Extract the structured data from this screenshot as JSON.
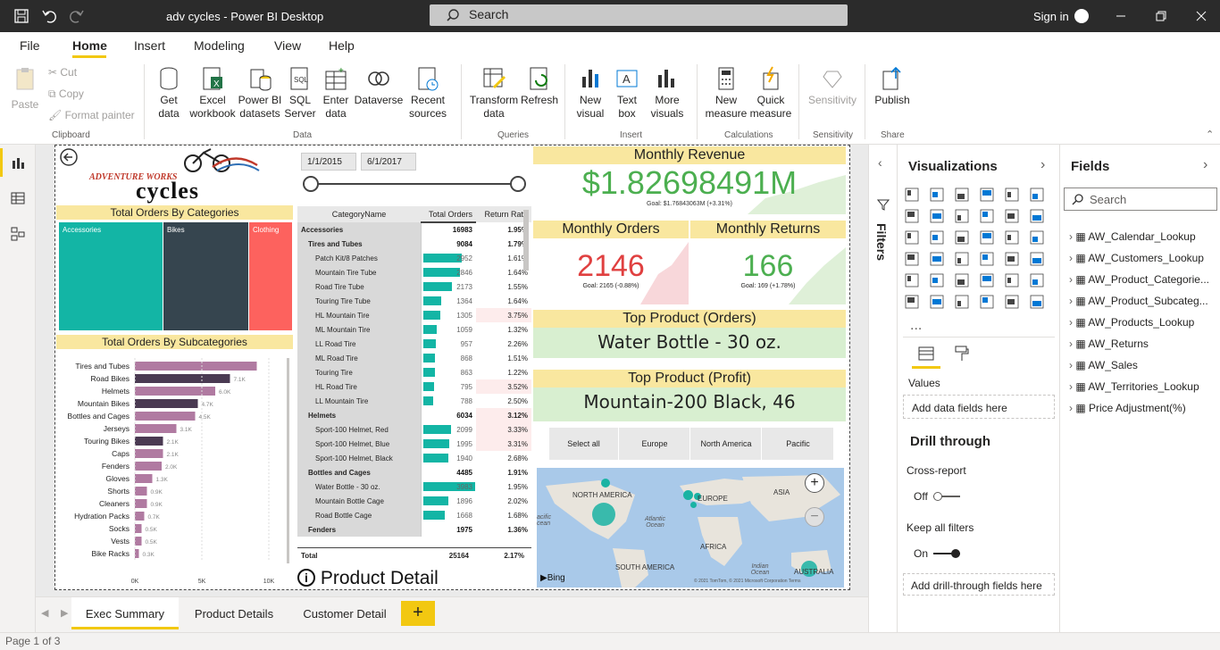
{
  "titlebar": {
    "title": "adv cycles - Power BI Desktop",
    "search": "Search",
    "sign_in": "Sign in"
  },
  "menu": [
    "File",
    "Home",
    "Insert",
    "Modeling",
    "View",
    "Help"
  ],
  "ribbon": {
    "paste": "Paste",
    "cut": "Cut",
    "copy": "Copy",
    "format_painter": "Format painter",
    "clipboard": "Clipboard",
    "get_data": "Get data",
    "excel": "Excel workbook",
    "pbi": "Power BI datasets",
    "sql": "SQL Server",
    "enter": "Enter data",
    "dataverse": "Dataverse",
    "recent": "Recent sources",
    "data": "Data",
    "transform": "Transform data",
    "refresh": "Refresh",
    "queries": "Queries",
    "new_visual": "New visual",
    "text_box": "Text box",
    "more_visuals": "More visuals",
    "insert": "Insert",
    "new_measure": "New measure",
    "quick_measure": "Quick measure",
    "calculations": "Calculations",
    "sensitivity": "Sensitivity",
    "sensitivity_group": "Sensitivity",
    "publish": "Publish",
    "share": "Share"
  },
  "report": {
    "logo_top": "ADVENTURE WORKS",
    "logo_bottom": "cycles",
    "date_from": "1/1/2015",
    "date_to": "6/1/2017",
    "orders_by_cat": "Total Orders By Categories",
    "treemap": [
      "Accessories",
      "Bikes",
      "Clothing"
    ],
    "orders_by_subcat": "Total Orders By Subcategories",
    "subcats": [
      {
        "name": "Tires and Tubes",
        "value": 9100,
        "label": ""
      },
      {
        "name": "Road Bikes",
        "value": 7100,
        "label": "7.1K"
      },
      {
        "name": "Helmets",
        "value": 6000,
        "label": "6.0K"
      },
      {
        "name": "Mountain Bikes",
        "value": 4700,
        "label": "4.7K"
      },
      {
        "name": "Bottles and Cages",
        "value": 4500,
        "label": "4.5K"
      },
      {
        "name": "Jerseys",
        "value": 3100,
        "label": "3.1K"
      },
      {
        "name": "Touring Bikes",
        "value": 2100,
        "label": "2.1K"
      },
      {
        "name": "Caps",
        "value": 2100,
        "label": "2.1K"
      },
      {
        "name": "Fenders",
        "value": 2000,
        "label": "2.0K"
      },
      {
        "name": "Gloves",
        "value": 1300,
        "label": "1.3K"
      },
      {
        "name": "Shorts",
        "value": 900,
        "label": "0.9K"
      },
      {
        "name": "Cleaners",
        "value": 900,
        "label": "0.9K"
      },
      {
        "name": "Hydration Packs",
        "value": 700,
        "label": "0.7K"
      },
      {
        "name": "Socks",
        "value": 500,
        "label": "0.5K"
      },
      {
        "name": "Vests",
        "value": 500,
        "label": "0.5K"
      },
      {
        "name": "Bike Racks",
        "value": 300,
        "label": "0.3K"
      }
    ],
    "subcat_axis": [
      "0K",
      "5K",
      "10K"
    ],
    "matrix_headers": [
      "CategoryName",
      "Total Orders",
      "Return Rate"
    ],
    "matrix_rows": [
      {
        "name": "Accessories",
        "orders": "16983",
        "rate": "1.95%",
        "lvl": 0,
        "bar": 0
      },
      {
        "name": "Tires and Tubes",
        "orders": "9084",
        "rate": "1.79%",
        "lvl": 1,
        "bar": 0
      },
      {
        "name": "Patch Kit/8 Patches",
        "orders": "2952",
        "rate": "1.61%",
        "lvl": 2,
        "bar": 2952
      },
      {
        "name": "Mountain Tire Tube",
        "orders": "2846",
        "rate": "1.64%",
        "lvl": 2,
        "bar": 2846
      },
      {
        "name": "Road Tire Tube",
        "orders": "2173",
        "rate": "1.55%",
        "lvl": 2,
        "bar": 2173
      },
      {
        "name": "Touring Tire Tube",
        "orders": "1364",
        "rate": "1.64%",
        "lvl": 2,
        "bar": 1364
      },
      {
        "name": "HL Mountain Tire",
        "orders": "1305",
        "rate": "3.75%",
        "lvl": 2,
        "bar": 1305
      },
      {
        "name": "ML Mountain Tire",
        "orders": "1059",
        "rate": "1.32%",
        "lvl": 2,
        "bar": 1059
      },
      {
        "name": "LL Road Tire",
        "orders": "957",
        "rate": "2.26%",
        "lvl": 2,
        "bar": 957
      },
      {
        "name": "ML Road Tire",
        "orders": "868",
        "rate": "1.51%",
        "lvl": 2,
        "bar": 868
      },
      {
        "name": "Touring Tire",
        "orders": "863",
        "rate": "1.22%",
        "lvl": 2,
        "bar": 863
      },
      {
        "name": "HL Road Tire",
        "orders": "795",
        "rate": "3.52%",
        "lvl": 2,
        "bar": 795
      },
      {
        "name": "LL Mountain Tire",
        "orders": "788",
        "rate": "2.50%",
        "lvl": 2,
        "bar": 788
      },
      {
        "name": "Helmets",
        "orders": "6034",
        "rate": "3.12%",
        "lvl": 1,
        "bar": 0
      },
      {
        "name": "Sport-100 Helmet, Red",
        "orders": "2099",
        "rate": "3.33%",
        "lvl": 2,
        "bar": 2099
      },
      {
        "name": "Sport-100 Helmet, Blue",
        "orders": "1995",
        "rate": "3.31%",
        "lvl": 2,
        "bar": 1995
      },
      {
        "name": "Sport-100 Helmet, Black",
        "orders": "1940",
        "rate": "2.68%",
        "lvl": 2,
        "bar": 1940
      },
      {
        "name": "Bottles and Cages",
        "orders": "4485",
        "rate": "1.91%",
        "lvl": 1,
        "bar": 0
      },
      {
        "name": "Water Bottle - 30 oz.",
        "orders": "3983",
        "rate": "1.95%",
        "lvl": 2,
        "bar": 3983
      },
      {
        "name": "Mountain Bottle Cage",
        "orders": "1896",
        "rate": "2.02%",
        "lvl": 2,
        "bar": 1896
      },
      {
        "name": "Road Bottle Cage",
        "orders": "1668",
        "rate": "1.68%",
        "lvl": 2,
        "bar": 1668
      },
      {
        "name": "Fenders",
        "orders": "1975",
        "rate": "1.36%",
        "lvl": 1,
        "bar": 0
      }
    ],
    "matrix_total": {
      "name": "Total",
      "orders": "25164",
      "rate": "2.17%"
    },
    "product_detail": "Product Detail",
    "monthly_revenue": "Monthly Revenue",
    "revenue_value": "$1.82698491M",
    "revenue_goal": "Goal: $1.76843063M (+3.31%)",
    "monthly_orders": "Monthly Orders",
    "orders_value": "2146",
    "orders_goal": "Goal: 2165 (-0.88%)",
    "monthly_returns": "Monthly Returns",
    "returns_value": "166",
    "returns_goal": "Goal: 169 (+1.78%)",
    "top_orders": "Top Product (Orders)",
    "top_orders_value": "Water Bottle - 30 oz.",
    "top_profit": "Top Product (Profit)",
    "top_profit_value": "Mountain-200 Black, 46",
    "regions": [
      "Select all",
      "Europe",
      "North America",
      "Pacific"
    ],
    "map_labels": [
      "NORTH AMERICA",
      "EUROPE",
      "ASIA",
      "Atlantic Ocean",
      "AFRICA",
      "SOUTH AMERICA",
      "Indian Ocean",
      "AUSTRALIA",
      "acific cean"
    ],
    "map_credit": "© 2021 TomTom, © 2021 Microsoft Corporation Terms",
    "bing": "Bing"
  },
  "filters": "Filters",
  "viz": {
    "title": "Visualizations",
    "values": "Values",
    "add_data": "Add data fields here",
    "drill": "Drill through",
    "cross": "Cross-report",
    "off": "Off",
    "keep": "Keep all filters",
    "on": "On",
    "add_drill": "Add drill-through fields here",
    "more": "..."
  },
  "fields": {
    "title": "Fields",
    "search": "Search",
    "items": [
      "AW_Calendar_Lookup",
      "AW_Customers_Lookup",
      "AW_Product_Categorie...",
      "AW_Product_Subcateg...",
      "AW_Products_Lookup",
      "AW_Returns",
      "AW_Sales",
      "AW_Territories_Lookup",
      "Price Adjustment(%)"
    ]
  },
  "tabs": [
    "Exec Summary",
    "Product Details",
    "Customer Detail"
  ],
  "status": "Page 1 of 3",
  "colors": {
    "teal": "#13b5a5",
    "dark": "#36454f",
    "red": "#fd625e",
    "purple": "#b07aa1",
    "dark_purple": "#3c2f4a",
    "yellow": "#f9e79f",
    "green": "#4caf50",
    "kpi_red": "#e04040",
    "accent": "#f2c811"
  }
}
